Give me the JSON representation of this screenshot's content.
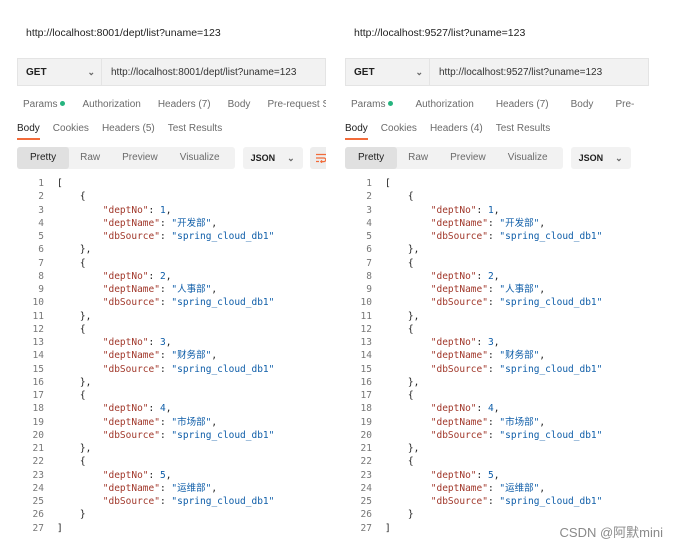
{
  "panels": [
    {
      "title": "http://localhost:8001/dept/list?uname=123",
      "method": "GET",
      "url": "http://localhost:8001/dept/list?uname=123",
      "request_tabs": [
        "Params",
        "Authorization",
        "Headers (7)",
        "Body",
        "Pre-request Sc"
      ],
      "response_tabs": [
        "Body",
        "Cookies",
        "Headers (5)",
        "Test Results"
      ],
      "view_modes": [
        "Pretty",
        "Raw",
        "Preview",
        "Visualize"
      ],
      "format": "JSON"
    },
    {
      "title": "http://localhost:9527/list?uname=123",
      "method": "GET",
      "url": "http://localhost:9527/list?uname=123",
      "request_tabs": [
        "Params",
        "Authorization",
        "Headers (7)",
        "Body",
        "Pre-"
      ],
      "response_tabs": [
        "Body",
        "Cookies",
        "Headers (4)",
        "Test Results"
      ],
      "view_modes": [
        "Pretty",
        "Raw",
        "Preview",
        "Visualize"
      ],
      "format": "JSON"
    }
  ],
  "records": [
    {
      "deptNo": 1,
      "deptName": "开发部",
      "dbSource": "spring_cloud_db1"
    },
    {
      "deptNo": 2,
      "deptName": "人事部",
      "dbSource": "spring_cloud_db1"
    },
    {
      "deptNo": 3,
      "deptName": "财务部",
      "dbSource": "spring_cloud_db1"
    },
    {
      "deptNo": 4,
      "deptName": "市场部",
      "dbSource": "spring_cloud_db1"
    },
    {
      "deptNo": 5,
      "deptName": "运维部",
      "dbSource": "spring_cloud_db1"
    }
  ],
  "watermark": "CSDN @阿默mini"
}
